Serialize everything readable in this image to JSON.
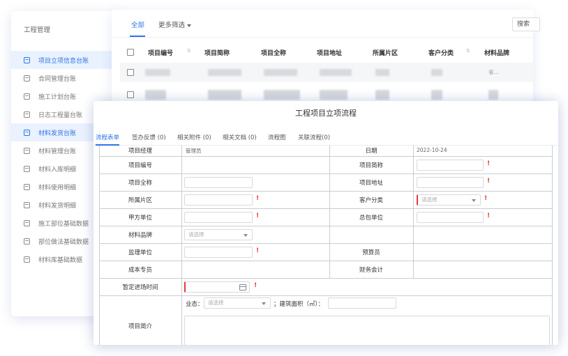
{
  "sidebar": {
    "title": "工程管理",
    "items": [
      {
        "label": "项目立项信息台账",
        "active": true
      },
      {
        "label": "合同管理台账",
        "active": false
      },
      {
        "label": "施工计划台账",
        "active": false
      },
      {
        "label": "日志工程量台账",
        "active": false
      },
      {
        "label": "材料发货台账",
        "active": true
      },
      {
        "label": "材料管理台账",
        "active": false
      },
      {
        "label": "材料入库明细",
        "active": false
      },
      {
        "label": "材料使用明细",
        "active": false
      },
      {
        "label": "材料发货明细",
        "active": false
      },
      {
        "label": "施工部位基础数据",
        "active": false
      },
      {
        "label": "部位做法基础数据",
        "active": false
      },
      {
        "label": "材料库基础数据",
        "active": false
      }
    ]
  },
  "list": {
    "tab_all": "全部",
    "tab_more": "更多筛选",
    "search_label": "搜索",
    "columns": [
      "项目编号",
      "项目简称",
      "项目全称",
      "项目地址",
      "所属片区",
      "客户分类",
      "材料品牌"
    ],
    "partial_cell": "省..."
  },
  "dialog": {
    "title": "工程项目立项流程",
    "tabs": [
      {
        "label": "流程表单",
        "active": true
      },
      {
        "label": "签办反馈 (0)",
        "active": false
      },
      {
        "label": "相关附件 (0)",
        "active": false
      },
      {
        "label": "相关文档 (0)",
        "active": false
      },
      {
        "label": "流程图",
        "active": false
      },
      {
        "label": "关联流程(0)",
        "active": false
      }
    ],
    "form": {
      "row0_left_label": "项目经理",
      "row0_left_value": "管理员",
      "row0_right_label": "日期",
      "row0_right_value": "2022-10-24",
      "project_no": "项目编号",
      "project_short": "项目简称",
      "project_full": "项目全称",
      "project_addr": "项目地址",
      "district": "所属片区",
      "customer_type": "客户分类",
      "party_a": "甲方单位",
      "general_contractor": "总包单位",
      "material_brand": "材料品牌",
      "supervisor": "监理单位",
      "budget_staff": "预算员",
      "cost_staff": "成本专员",
      "finance": "财务会计",
      "entry_time": "暂定进场时间",
      "intro": "项目简介",
      "business_label": "业态：",
      "area_label": "；建筑面积（㎡）：",
      "select_placeholder": "请选择",
      "required_mark": "!"
    }
  }
}
